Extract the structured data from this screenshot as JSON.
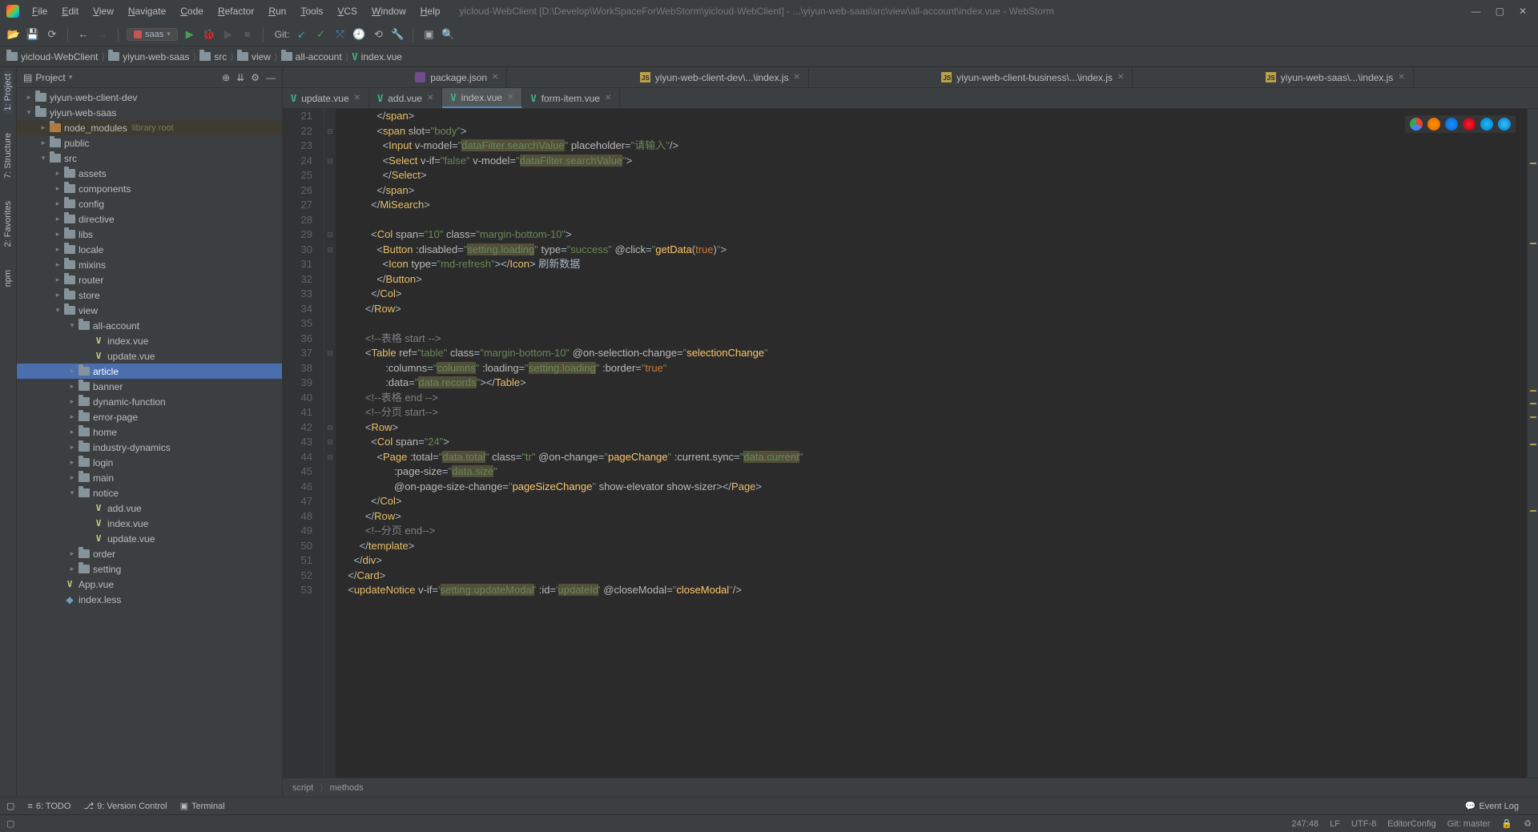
{
  "window_title": "yicloud-WebClient [D:\\Develop\\WorkSpaceForWebStorm\\yicloud-WebClient] - ...\\yiyun-web-saas\\src\\view\\all-account\\index.vue - WebStorm",
  "menu": [
    "File",
    "Edit",
    "View",
    "Navigate",
    "Code",
    "Refactor",
    "Run",
    "Tools",
    "VCS",
    "Window",
    "Help"
  ],
  "run_config": "saas",
  "git_label": "Git:",
  "nav_crumbs": [
    "yicloud-WebClient",
    "yiyun-web-saas",
    "src",
    "view",
    "all-account",
    "index.vue"
  ],
  "project_panel_title": "Project",
  "tree": [
    {
      "indent": 0,
      "arrow": "closed",
      "icon": "folder",
      "label": "yiyun-web-client-dev"
    },
    {
      "indent": 0,
      "arrow": "open",
      "icon": "folder",
      "label": "yiyun-web-saas"
    },
    {
      "indent": 1,
      "arrow": "closed",
      "icon": "folder-orange",
      "label": "node_modules",
      "note": "library root",
      "lib": true
    },
    {
      "indent": 1,
      "arrow": "closed",
      "icon": "folder",
      "label": "public"
    },
    {
      "indent": 1,
      "arrow": "open",
      "icon": "folder",
      "label": "src"
    },
    {
      "indent": 2,
      "arrow": "closed",
      "icon": "folder",
      "label": "assets"
    },
    {
      "indent": 2,
      "arrow": "closed",
      "icon": "folder",
      "label": "components"
    },
    {
      "indent": 2,
      "arrow": "closed",
      "icon": "folder",
      "label": "config"
    },
    {
      "indent": 2,
      "arrow": "closed",
      "icon": "folder",
      "label": "directive"
    },
    {
      "indent": 2,
      "arrow": "closed",
      "icon": "folder",
      "label": "libs"
    },
    {
      "indent": 2,
      "arrow": "closed",
      "icon": "folder",
      "label": "locale"
    },
    {
      "indent": 2,
      "arrow": "closed",
      "icon": "folder",
      "label": "mixins"
    },
    {
      "indent": 2,
      "arrow": "closed",
      "icon": "folder",
      "label": "router"
    },
    {
      "indent": 2,
      "arrow": "closed",
      "icon": "folder",
      "label": "store"
    },
    {
      "indent": 2,
      "arrow": "open",
      "icon": "folder",
      "label": "view"
    },
    {
      "indent": 3,
      "arrow": "open",
      "icon": "folder",
      "label": "all-account"
    },
    {
      "indent": 4,
      "arrow": "none",
      "icon": "vue",
      "label": "index.vue"
    },
    {
      "indent": 4,
      "arrow": "none",
      "icon": "vue",
      "label": "update.vue"
    },
    {
      "indent": 3,
      "arrow": "closed",
      "icon": "folder",
      "label": "article",
      "selected": true
    },
    {
      "indent": 3,
      "arrow": "closed",
      "icon": "folder",
      "label": "banner"
    },
    {
      "indent": 3,
      "arrow": "closed",
      "icon": "folder",
      "label": "dynamic-function"
    },
    {
      "indent": 3,
      "arrow": "closed",
      "icon": "folder",
      "label": "error-page"
    },
    {
      "indent": 3,
      "arrow": "closed",
      "icon": "folder",
      "label": "home"
    },
    {
      "indent": 3,
      "arrow": "closed",
      "icon": "folder",
      "label": "industry-dynamics"
    },
    {
      "indent": 3,
      "arrow": "closed",
      "icon": "folder",
      "label": "login"
    },
    {
      "indent": 3,
      "arrow": "closed",
      "icon": "folder",
      "label": "main"
    },
    {
      "indent": 3,
      "arrow": "open",
      "icon": "folder",
      "label": "notice"
    },
    {
      "indent": 4,
      "arrow": "none",
      "icon": "vue",
      "label": "add.vue"
    },
    {
      "indent": 4,
      "arrow": "none",
      "icon": "vue",
      "label": "index.vue"
    },
    {
      "indent": 4,
      "arrow": "none",
      "icon": "vue",
      "label": "update.vue"
    },
    {
      "indent": 3,
      "arrow": "closed",
      "icon": "folder",
      "label": "order"
    },
    {
      "indent": 3,
      "arrow": "closed",
      "icon": "folder",
      "label": "setting"
    },
    {
      "indent": 2,
      "arrow": "none",
      "icon": "vue",
      "label": "App.vue"
    },
    {
      "indent": 2,
      "arrow": "none",
      "icon": "less",
      "label": "index.less"
    }
  ],
  "tabs1": [
    {
      "icon": "json",
      "label": "package.json",
      "active": false
    },
    {
      "icon": "js",
      "label": "yiyun-web-client-dev\\...\\index.js",
      "active": false
    },
    {
      "icon": "js",
      "label": "yiyun-web-client-business\\...\\index.js",
      "active": false
    },
    {
      "icon": "js",
      "label": "yiyun-web-saas\\...\\index.js",
      "active": false
    }
  ],
  "tabs2": [
    {
      "icon": "vue",
      "label": "update.vue",
      "active": false
    },
    {
      "icon": "vue",
      "label": "add.vue",
      "active": false
    },
    {
      "icon": "vue",
      "label": "index.vue",
      "active": true
    },
    {
      "icon": "vue",
      "label": "form-item.vue",
      "active": false
    }
  ],
  "line_start": 21,
  "line_end": 53,
  "crumb_trail": [
    "script",
    "methods"
  ],
  "bottom_tools": [
    {
      "icon": "≡",
      "label": "6: TODO"
    },
    {
      "icon": "⎇",
      "label": "9: Version Control"
    },
    {
      "icon": "▣",
      "label": "Terminal"
    }
  ],
  "event_log": "Event Log",
  "status": {
    "pos": "247:48",
    "line_sep": "LF",
    "encoding": "UTF-8",
    "editorconfig": "EditorConfig",
    "git": "Git: master"
  },
  "left_tool_windows": [
    "1: Project",
    "7: Structure",
    "2: Favorites",
    "npm"
  ]
}
